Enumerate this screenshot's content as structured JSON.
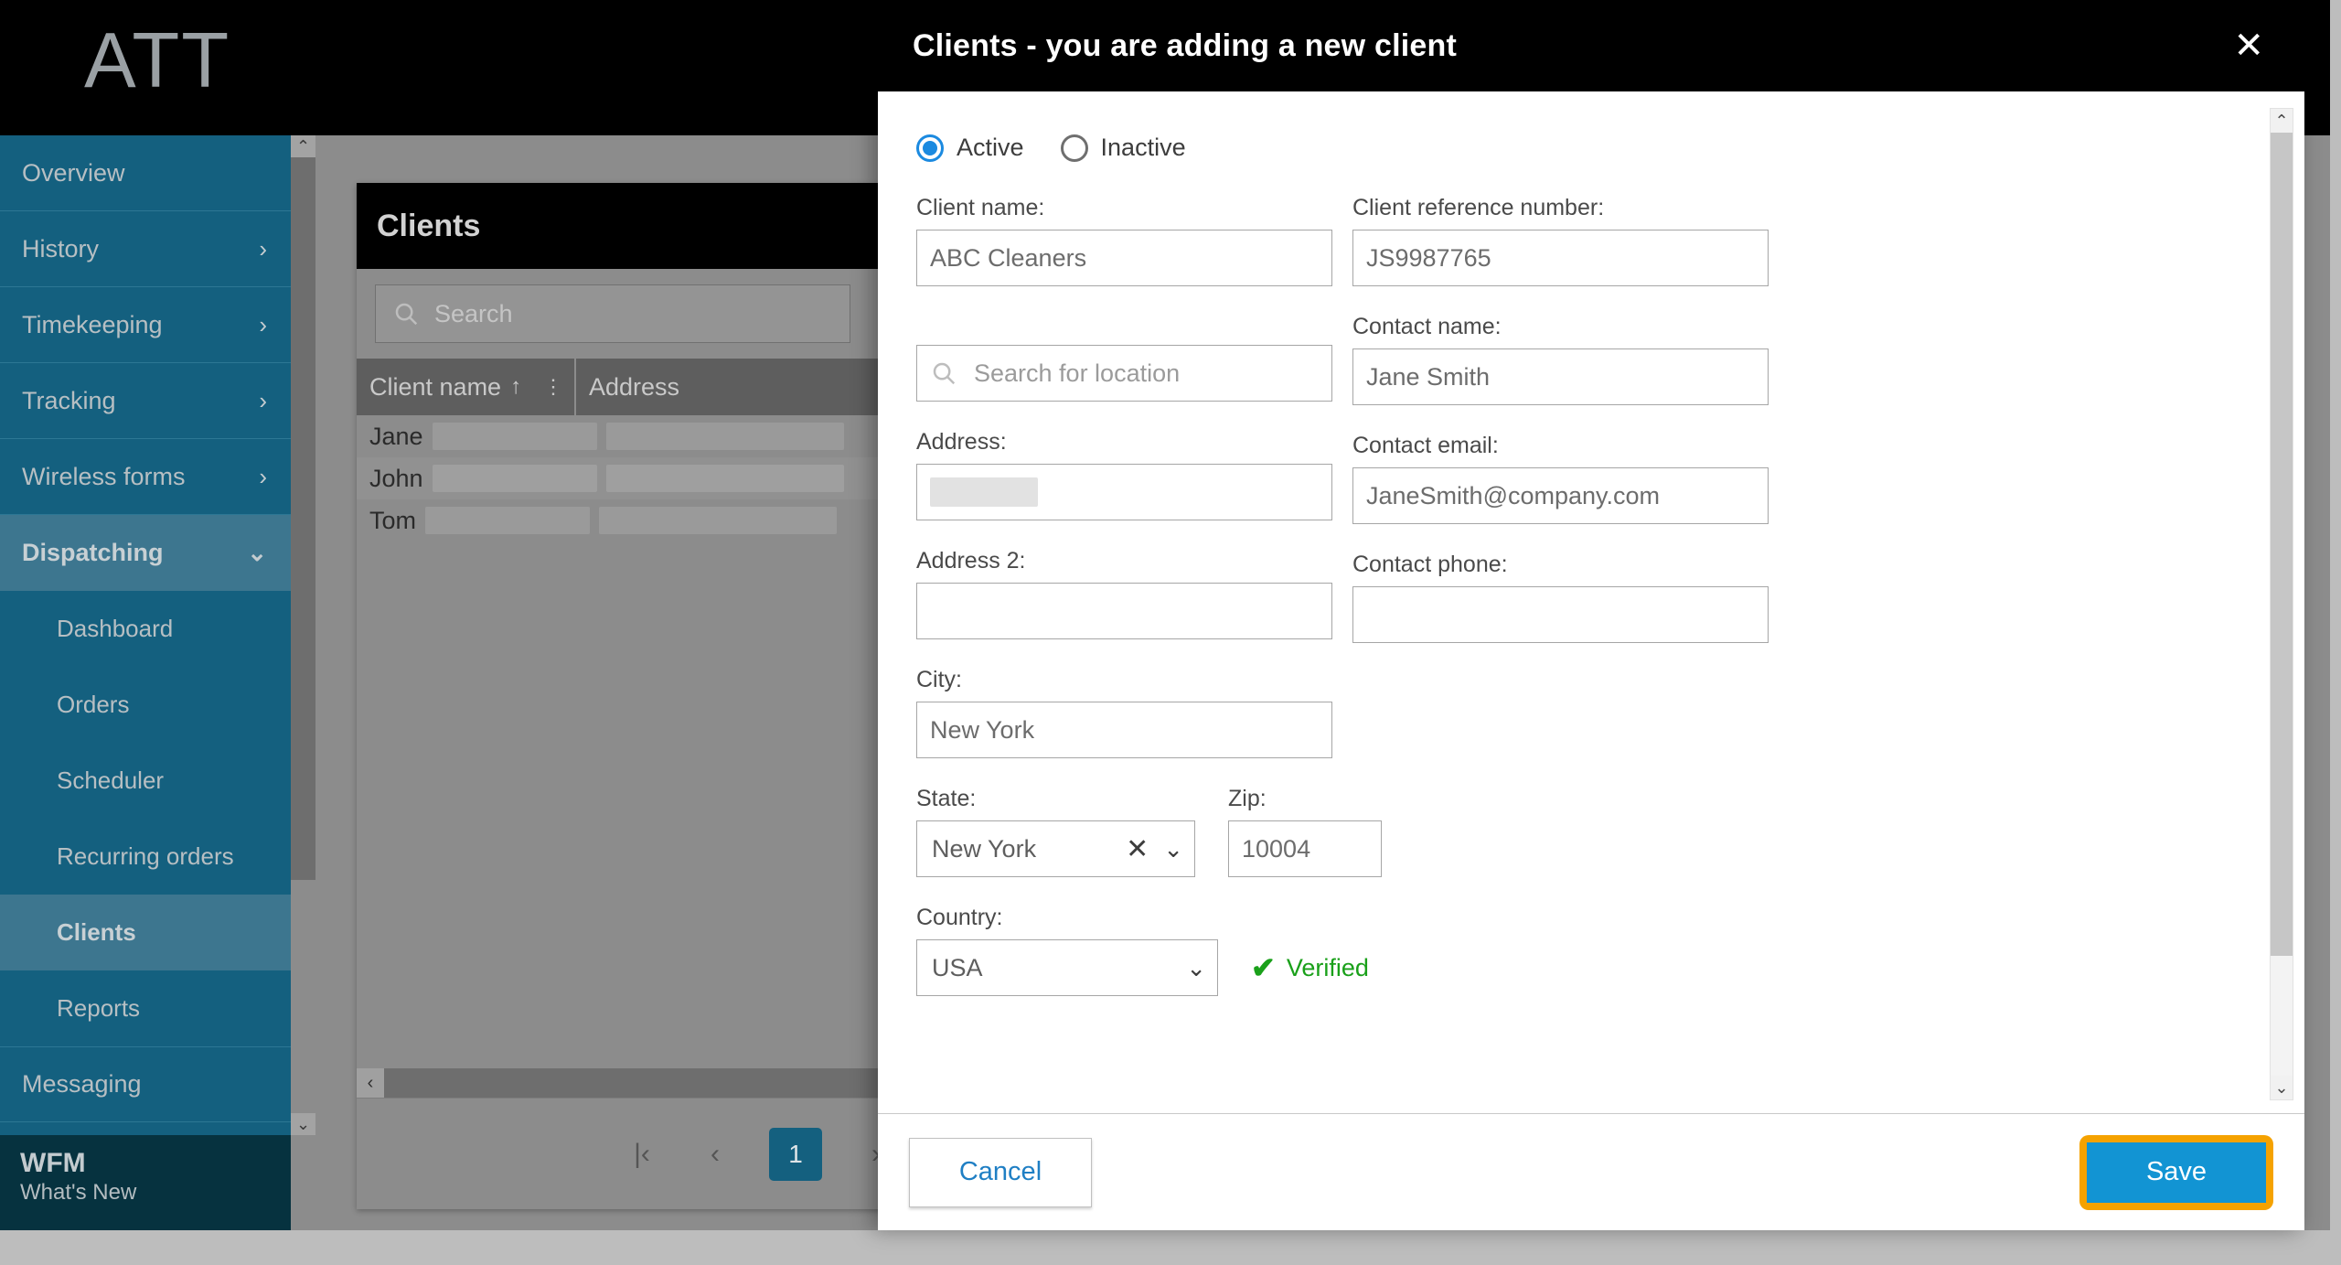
{
  "app": {
    "logo_text": "ATT"
  },
  "sidebar": {
    "items": [
      {
        "label": "Overview",
        "chevron": "",
        "state": "normal"
      },
      {
        "label": "History",
        "chevron": "›",
        "state": "normal"
      },
      {
        "label": "Timekeeping",
        "chevron": "›",
        "state": "normal"
      },
      {
        "label": "Tracking",
        "chevron": "›",
        "state": "normal"
      },
      {
        "label": "Wireless forms",
        "chevron": "›",
        "state": "normal"
      },
      {
        "label": "Dispatching",
        "chevron": "⌄",
        "state": "expanded"
      }
    ],
    "sub_items": [
      {
        "label": "Dashboard",
        "state": "normal"
      },
      {
        "label": "Orders",
        "state": "normal"
      },
      {
        "label": "Scheduler",
        "state": "normal"
      },
      {
        "label": "Recurring orders",
        "state": "normal"
      },
      {
        "label": "Clients",
        "state": "active"
      },
      {
        "label": "Reports",
        "state": "normal"
      }
    ],
    "trailing_items": [
      {
        "label": "Messaging",
        "chevron": "",
        "state": "normal"
      }
    ],
    "footer": {
      "title": "WFM",
      "subtitle": "What's New"
    }
  },
  "clients_panel": {
    "title": "Clients",
    "search_placeholder": "Search",
    "columns": [
      {
        "label": "Client name",
        "sort": "↑",
        "kebab": "⋮"
      },
      {
        "label": "Address",
        "sort": "",
        "kebab": "⋮"
      }
    ],
    "rows": [
      {
        "client_name": "Jane"
      },
      {
        "client_name": "John"
      },
      {
        "client_name": "Tom"
      }
    ],
    "pagination": {
      "first": "|‹",
      "prev": "‹",
      "current_page": "1",
      "next": "›",
      "last": "›|"
    },
    "hscroll_left": "‹"
  },
  "modal": {
    "title": "Clients - you are adding a new client",
    "close_label": "✕",
    "status": {
      "options": [
        {
          "label": "Active",
          "selected": true
        },
        {
          "label": "Inactive",
          "selected": false
        }
      ]
    },
    "fields": {
      "client_name": {
        "label": "Client name:",
        "value": "ABC Cleaners"
      },
      "client_reference_number": {
        "label": "Client reference number:",
        "value": "JS9987765"
      },
      "location_search": {
        "label": "",
        "placeholder": "Search for location",
        "value": ""
      },
      "contact_name": {
        "label": "Contact name:",
        "value": "Jane Smith"
      },
      "address": {
        "label": "Address:",
        "value": ""
      },
      "contact_email": {
        "label": "Contact email:",
        "value": "JaneSmith@company.com"
      },
      "address2": {
        "label": "Address 2:",
        "value": ""
      },
      "contact_phone": {
        "label": "Contact phone:",
        "value": ""
      },
      "city": {
        "label": "City:",
        "value": "New York"
      },
      "state": {
        "label": "State:",
        "value": "New York",
        "clear_label": "✕",
        "chevron": "⌄"
      },
      "zip": {
        "label": "Zip:",
        "value": "10004"
      },
      "country": {
        "label": "Country:",
        "value": "USA",
        "chevron": "⌄"
      }
    },
    "verified": {
      "icon": "✔",
      "label": "Verified"
    },
    "footer": {
      "cancel_label": "Cancel",
      "save_label": "Save"
    },
    "scrollbar": {
      "up": "⌃",
      "down": "⌄"
    }
  },
  "colors": {
    "sidebar": "#14607f",
    "sidebar_active": "#3d768f",
    "accent_blue": "#1294d3",
    "radio_blue": "#1b8ae0",
    "highlight_orange": "#f5a200",
    "verified_green": "#1aa01a"
  }
}
